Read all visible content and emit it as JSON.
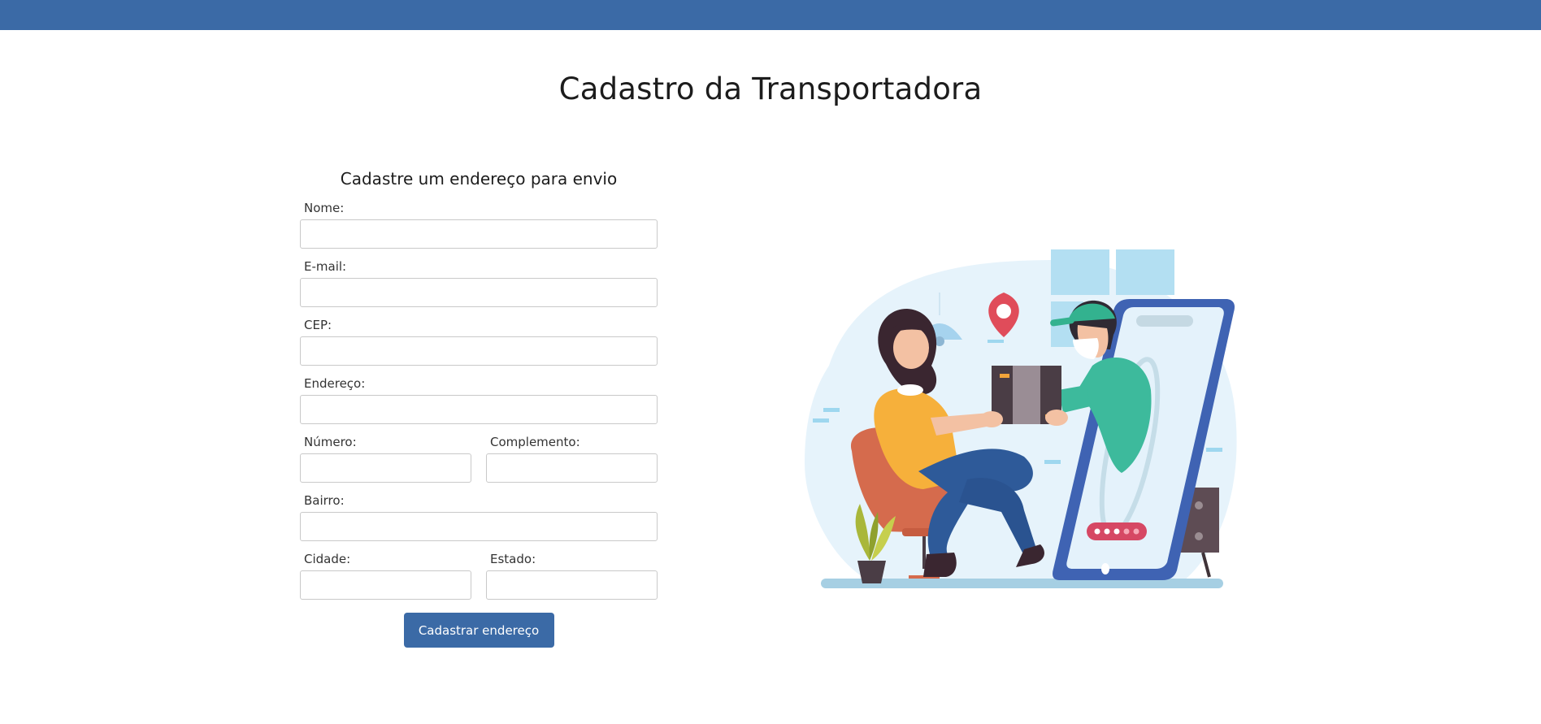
{
  "page": {
    "title": "Cadastro da Transportadora"
  },
  "colors": {
    "topbar": "#3b6aa6",
    "button": "#3b6aa6"
  },
  "form": {
    "heading": "Cadastre um endereço para envio",
    "fields": {
      "nome": {
        "label": "Nome:",
        "value": ""
      },
      "email": {
        "label": "E-mail:",
        "value": ""
      },
      "cep": {
        "label": "CEP:",
        "value": ""
      },
      "endereco": {
        "label": "Endereço:",
        "value": ""
      },
      "numero": {
        "label": "Número:",
        "value": ""
      },
      "complemento": {
        "label": "Complemento:",
        "value": ""
      },
      "bairro": {
        "label": "Bairro:",
        "value": ""
      },
      "cidade": {
        "label": "Cidade:",
        "value": ""
      },
      "estado": {
        "label": "Estado:",
        "value": ""
      }
    },
    "submit_label": "Cadastrar endereço"
  },
  "illustration": {
    "icon": "delivery-illustration"
  }
}
